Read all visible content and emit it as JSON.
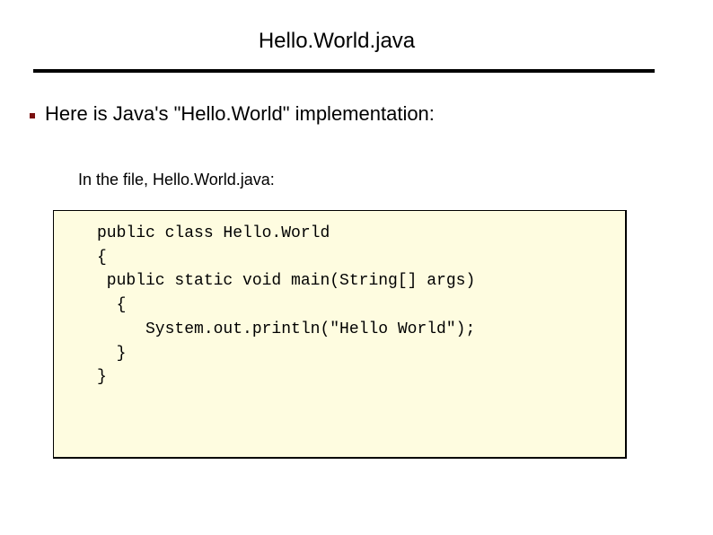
{
  "slide": {
    "title": "Hello.World.java",
    "bullet": "Here is Java's \"Hello.World\" implementation:",
    "subtext": "In the file, Hello.World.java:",
    "code_lines": [
      "public class Hello.World",
      "{",
      " public static void main(String[] args)",
      "  {",
      "     System.out.println(\"Hello World\");",
      "  }",
      "}"
    ],
    "bullet_color": "#7a0f0f",
    "code_background": "#fefce0"
  }
}
